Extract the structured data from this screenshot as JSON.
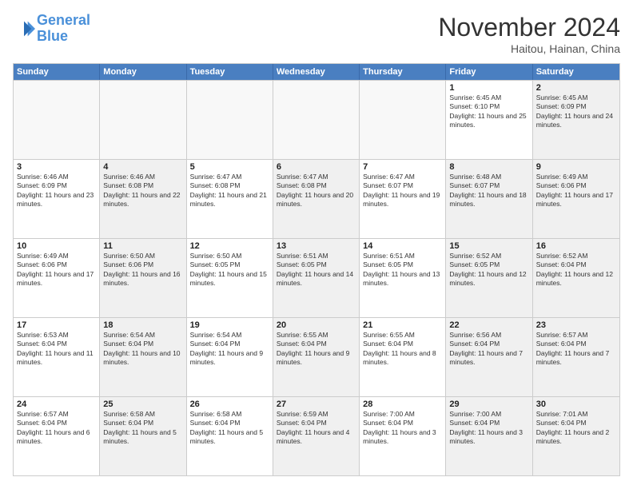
{
  "header": {
    "logo_line1": "General",
    "logo_line2": "Blue",
    "month_title": "November 2024",
    "location": "Haitou, Hainan, China"
  },
  "weekdays": [
    "Sunday",
    "Monday",
    "Tuesday",
    "Wednesday",
    "Thursday",
    "Friday",
    "Saturday"
  ],
  "weeks": [
    [
      {
        "day": "",
        "info": "",
        "shaded": true
      },
      {
        "day": "",
        "info": "",
        "shaded": true
      },
      {
        "day": "",
        "info": "",
        "shaded": true
      },
      {
        "day": "",
        "info": "",
        "shaded": true
      },
      {
        "day": "",
        "info": "",
        "shaded": true
      },
      {
        "day": "1",
        "info": "Sunrise: 6:45 AM\nSunset: 6:10 PM\nDaylight: 11 hours and 25 minutes.",
        "shaded": false
      },
      {
        "day": "2",
        "info": "Sunrise: 6:45 AM\nSunset: 6:09 PM\nDaylight: 11 hours and 24 minutes.",
        "shaded": true
      }
    ],
    [
      {
        "day": "3",
        "info": "Sunrise: 6:46 AM\nSunset: 6:09 PM\nDaylight: 11 hours and 23 minutes.",
        "shaded": false
      },
      {
        "day": "4",
        "info": "Sunrise: 6:46 AM\nSunset: 6:08 PM\nDaylight: 11 hours and 22 minutes.",
        "shaded": true
      },
      {
        "day": "5",
        "info": "Sunrise: 6:47 AM\nSunset: 6:08 PM\nDaylight: 11 hours and 21 minutes.",
        "shaded": false
      },
      {
        "day": "6",
        "info": "Sunrise: 6:47 AM\nSunset: 6:08 PM\nDaylight: 11 hours and 20 minutes.",
        "shaded": true
      },
      {
        "day": "7",
        "info": "Sunrise: 6:47 AM\nSunset: 6:07 PM\nDaylight: 11 hours and 19 minutes.",
        "shaded": false
      },
      {
        "day": "8",
        "info": "Sunrise: 6:48 AM\nSunset: 6:07 PM\nDaylight: 11 hours and 18 minutes.",
        "shaded": true
      },
      {
        "day": "9",
        "info": "Sunrise: 6:49 AM\nSunset: 6:06 PM\nDaylight: 11 hours and 17 minutes.",
        "shaded": true
      }
    ],
    [
      {
        "day": "10",
        "info": "Sunrise: 6:49 AM\nSunset: 6:06 PM\nDaylight: 11 hours and 17 minutes.",
        "shaded": false
      },
      {
        "day": "11",
        "info": "Sunrise: 6:50 AM\nSunset: 6:06 PM\nDaylight: 11 hours and 16 minutes.",
        "shaded": true
      },
      {
        "day": "12",
        "info": "Sunrise: 6:50 AM\nSunset: 6:05 PM\nDaylight: 11 hours and 15 minutes.",
        "shaded": false
      },
      {
        "day": "13",
        "info": "Sunrise: 6:51 AM\nSunset: 6:05 PM\nDaylight: 11 hours and 14 minutes.",
        "shaded": true
      },
      {
        "day": "14",
        "info": "Sunrise: 6:51 AM\nSunset: 6:05 PM\nDaylight: 11 hours and 13 minutes.",
        "shaded": false
      },
      {
        "day": "15",
        "info": "Sunrise: 6:52 AM\nSunset: 6:05 PM\nDaylight: 11 hours and 12 minutes.",
        "shaded": true
      },
      {
        "day": "16",
        "info": "Sunrise: 6:52 AM\nSunset: 6:04 PM\nDaylight: 11 hours and 12 minutes.",
        "shaded": true
      }
    ],
    [
      {
        "day": "17",
        "info": "Sunrise: 6:53 AM\nSunset: 6:04 PM\nDaylight: 11 hours and 11 minutes.",
        "shaded": false
      },
      {
        "day": "18",
        "info": "Sunrise: 6:54 AM\nSunset: 6:04 PM\nDaylight: 11 hours and 10 minutes.",
        "shaded": true
      },
      {
        "day": "19",
        "info": "Sunrise: 6:54 AM\nSunset: 6:04 PM\nDaylight: 11 hours and 9 minutes.",
        "shaded": false
      },
      {
        "day": "20",
        "info": "Sunrise: 6:55 AM\nSunset: 6:04 PM\nDaylight: 11 hours and 9 minutes.",
        "shaded": true
      },
      {
        "day": "21",
        "info": "Sunrise: 6:55 AM\nSunset: 6:04 PM\nDaylight: 11 hours and 8 minutes.",
        "shaded": false
      },
      {
        "day": "22",
        "info": "Sunrise: 6:56 AM\nSunset: 6:04 PM\nDaylight: 11 hours and 7 minutes.",
        "shaded": true
      },
      {
        "day": "23",
        "info": "Sunrise: 6:57 AM\nSunset: 6:04 PM\nDaylight: 11 hours and 7 minutes.",
        "shaded": true
      }
    ],
    [
      {
        "day": "24",
        "info": "Sunrise: 6:57 AM\nSunset: 6:04 PM\nDaylight: 11 hours and 6 minutes.",
        "shaded": false
      },
      {
        "day": "25",
        "info": "Sunrise: 6:58 AM\nSunset: 6:04 PM\nDaylight: 11 hours and 5 minutes.",
        "shaded": true
      },
      {
        "day": "26",
        "info": "Sunrise: 6:58 AM\nSunset: 6:04 PM\nDaylight: 11 hours and 5 minutes.",
        "shaded": false
      },
      {
        "day": "27",
        "info": "Sunrise: 6:59 AM\nSunset: 6:04 PM\nDaylight: 11 hours and 4 minutes.",
        "shaded": true
      },
      {
        "day": "28",
        "info": "Sunrise: 7:00 AM\nSunset: 6:04 PM\nDaylight: 11 hours and 3 minutes.",
        "shaded": false
      },
      {
        "day": "29",
        "info": "Sunrise: 7:00 AM\nSunset: 6:04 PM\nDaylight: 11 hours and 3 minutes.",
        "shaded": true
      },
      {
        "day": "30",
        "info": "Sunrise: 7:01 AM\nSunset: 6:04 PM\nDaylight: 11 hours and 2 minutes.",
        "shaded": true
      }
    ]
  ]
}
